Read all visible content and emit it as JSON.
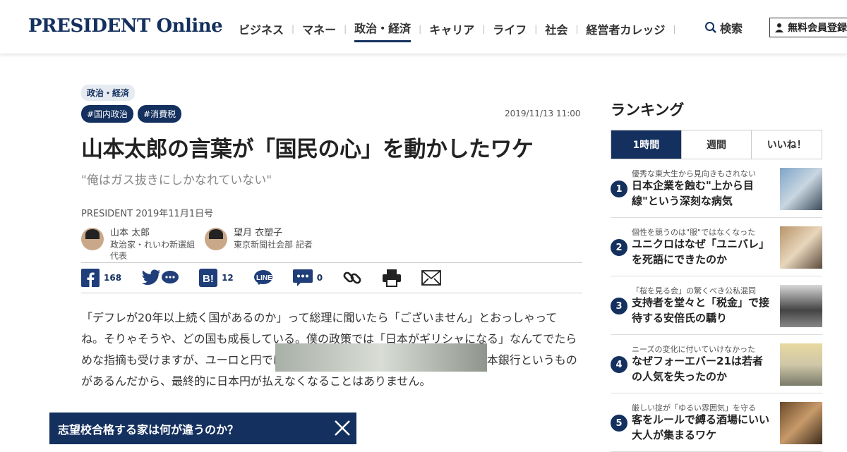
{
  "header": {
    "logo": "PRESIDENT Online",
    "nav": [
      "ビジネス",
      "マネー",
      "政治・経済",
      "キャリア",
      "ライフ",
      "社会",
      "経営者カレッジ"
    ],
    "nav_active": 2,
    "search_label": "検索",
    "member_label": "無料会員登録"
  },
  "article": {
    "category": "政治・経済",
    "tags": [
      "#国内政治",
      "#消費税"
    ],
    "date": "2019/11/13 11:00",
    "title": "山本太郎の言葉が「国民の心」を動かしたワケ",
    "subtitle": "\"俺はガス抜きにしかなれていない\"",
    "source": "PRESIDENT 2019年11月1日号",
    "authors": [
      {
        "name": "山本 太郎",
        "role": "政治家・れいわ新選組",
        "role2": "代表"
      },
      {
        "name": "望月 衣塑子",
        "role": "東京新聞社会部 記者",
        "role2": ""
      }
    ],
    "share": {
      "facebook": "168",
      "hatena": "12",
      "comments": "0"
    },
    "body": "「デフレが20年以上続く国があるのか」って総理に聞いたら「ございません」とおっしゃってね。そりゃそうや、どの国も成長している。僕の政策では「日本がギリシャになる」なんてでたらめな指摘も受けますが、ユーロと円では、通貨の独自性が全然違う。こちらは日本銀行というものがあるんだから、最終的に日本円が払えなくなることはありません。"
  },
  "banner": {
    "text": "志望校合格する家は何が違うのか？"
  },
  "ranking": {
    "title": "ランキング",
    "tabs": [
      "1時間",
      "週間",
      "いいね！"
    ],
    "items": [
      {
        "rank": "1",
        "kicker": "優秀な東大生から見向きもされない",
        "title": "日本企業を蝕む\"上から目線\"という深刻な病気"
      },
      {
        "rank": "2",
        "kicker": "個性を競うのは\"服\"ではなくなった",
        "title": "ユニクロはなぜ「ユニバレ」を死語にできたのか"
      },
      {
        "rank": "3",
        "kicker": "「桜を見る会」の驚くべき公私混同",
        "title": "支持者を堂々と「税金」で接待する安倍氏の驕り"
      },
      {
        "rank": "4",
        "kicker": "ニーズの変化に付いていけなかった",
        "title": "なぜフォーエバー21は若者の人気を失ったのか"
      },
      {
        "rank": "5",
        "kicker": "厳しい掟が「ゆるい雰囲気」を守る",
        "title": "客をルールで縛る酒場にいい大人が集まるワケ"
      }
    ]
  }
}
